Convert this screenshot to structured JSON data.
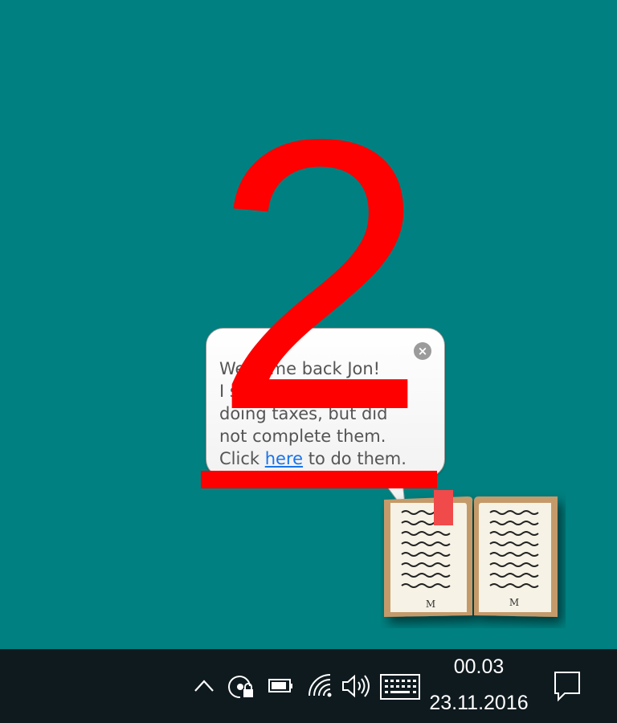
{
  "annotation": {
    "step_number": "2",
    "color": "#ff0000"
  },
  "notification": {
    "line1": "Welcome back Jon!",
    "line2": "I see you started",
    "line3": "doing taxes, but did",
    "line4": "not complete them.",
    "line5_before": "Click ",
    "link_text": "here",
    "line5_after": " to do them.",
    "close_icon": "close-icon"
  },
  "book_app": {
    "left_page_mark": "M",
    "right_page_mark": "M",
    "colors": {
      "cover": "#c59a6b",
      "page": "#f6f3e6",
      "bookmark": "#f04a4a",
      "text_lines": "#222222"
    }
  },
  "taskbar": {
    "icons": [
      "chevron-up-icon",
      "location-icon",
      "battery-icon",
      "wifi-icon",
      "volume-icon",
      "keyboard-icon"
    ],
    "clock": {
      "time": "00.03",
      "date": "23.11.2016"
    },
    "action_center_icon": "notification-icon",
    "background": "#0f1a1f"
  },
  "desktop": {
    "background": "#008080"
  }
}
